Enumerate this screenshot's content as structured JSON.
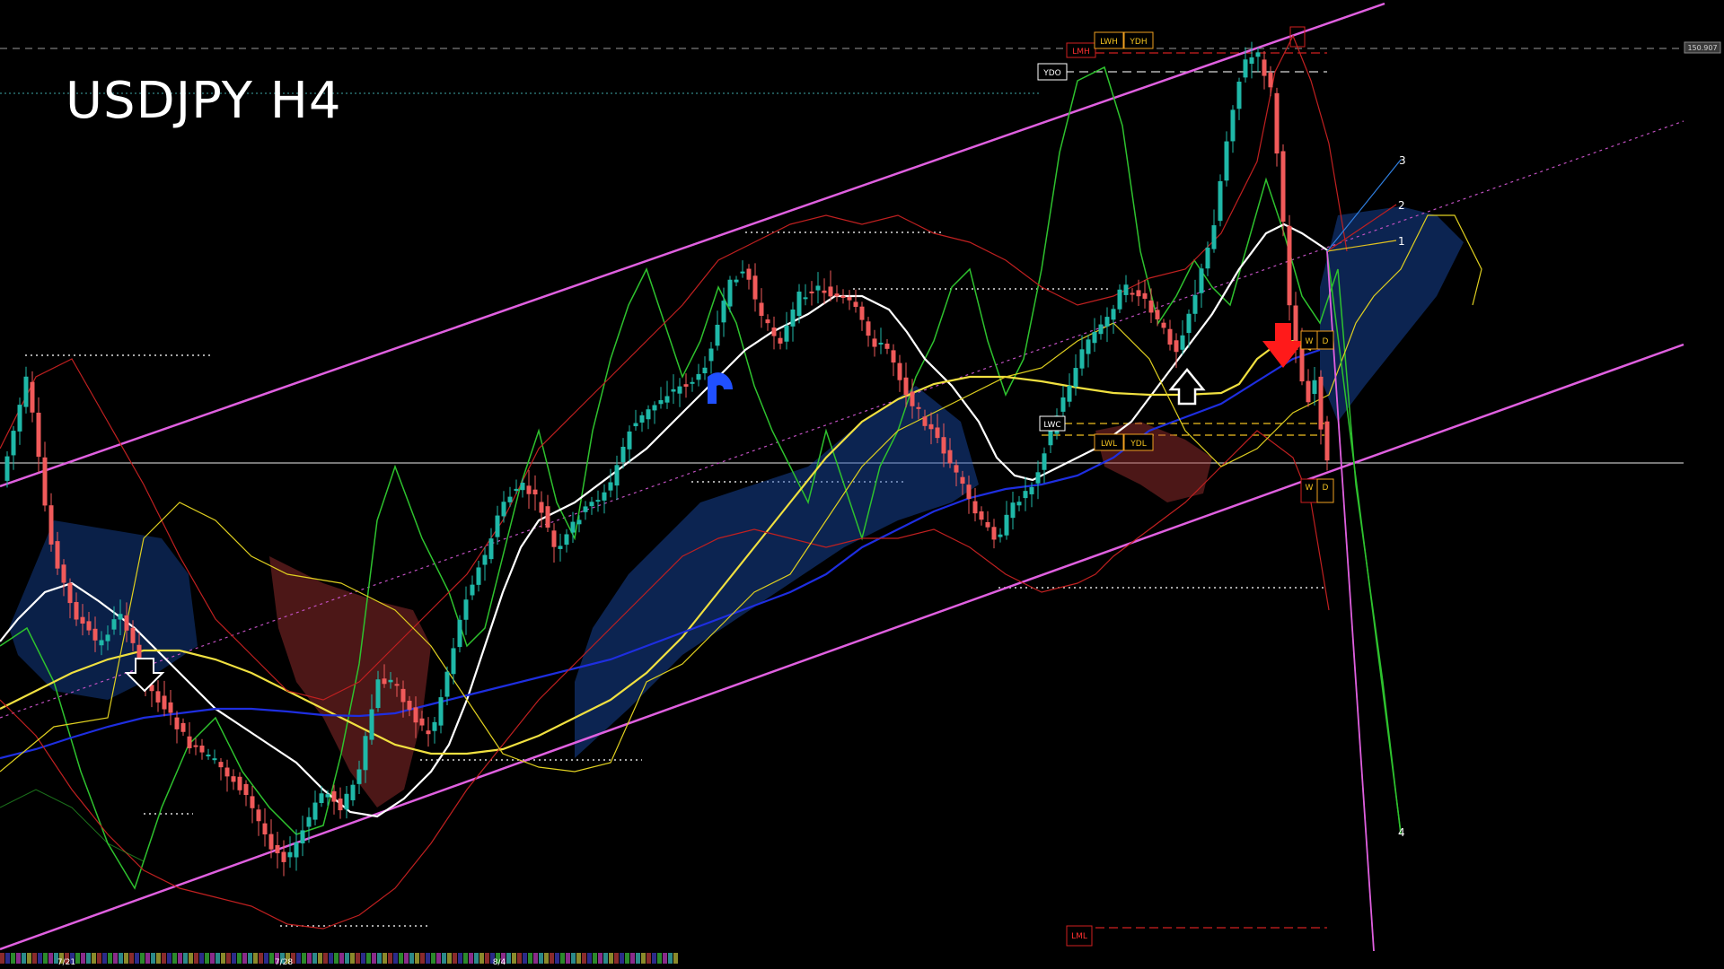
{
  "chart_data": {
    "type": "candlestick",
    "title": "USDJPY H4",
    "price_tag": "150.907",
    "x_ticks": [
      "7/21",
      "7/28",
      "8/4"
    ],
    "level_labels": [
      "LMH",
      "LWH",
      "YDH",
      "YDO",
      "LWC",
      "LWL",
      "YDL",
      "LML"
    ],
    "marker_labels": [
      "W",
      "D",
      "W",
      "D"
    ],
    "projection_labels": [
      "1",
      "2",
      "3",
      "4"
    ],
    "grid": false,
    "colors": {
      "bull": "#1fb8a8",
      "bear": "#f05a5a",
      "channel": "#e060e0",
      "cloud_bull": "#1a4fb3",
      "cloud_bear": "#a83232",
      "ma_white": "#ffffff",
      "ma_yellow": "#f0e040",
      "ma_blue": "#1e2ee0",
      "oscillator": "#2ec22e"
    }
  }
}
